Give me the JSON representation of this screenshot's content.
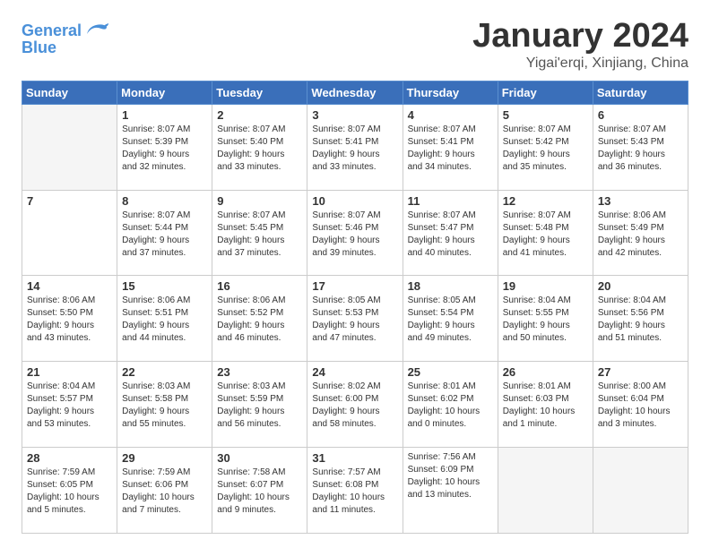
{
  "logo": {
    "line1": "General",
    "line2": "Blue"
  },
  "title": "January 2024",
  "subtitle": "Yigai'erqi, Xinjiang, China",
  "weekdays": [
    "Sunday",
    "Monday",
    "Tuesday",
    "Wednesday",
    "Thursday",
    "Friday",
    "Saturday"
  ],
  "weeks": [
    [
      {
        "day": "",
        "info": ""
      },
      {
        "day": "1",
        "info": "Sunrise: 8:07 AM\nSunset: 5:39 PM\nDaylight: 9 hours\nand 32 minutes."
      },
      {
        "day": "2",
        "info": "Sunrise: 8:07 AM\nSunset: 5:40 PM\nDaylight: 9 hours\nand 33 minutes."
      },
      {
        "day": "3",
        "info": "Sunrise: 8:07 AM\nSunset: 5:41 PM\nDaylight: 9 hours\nand 33 minutes."
      },
      {
        "day": "4",
        "info": "Sunrise: 8:07 AM\nSunset: 5:41 PM\nDaylight: 9 hours\nand 34 minutes."
      },
      {
        "day": "5",
        "info": "Sunrise: 8:07 AM\nSunset: 5:42 PM\nDaylight: 9 hours\nand 35 minutes."
      },
      {
        "day": "6",
        "info": "Sunrise: 8:07 AM\nSunset: 5:43 PM\nDaylight: 9 hours\nand 36 minutes."
      }
    ],
    [
      {
        "day": "7",
        "info": ""
      },
      {
        "day": "8",
        "info": "Sunrise: 8:07 AM\nSunset: 5:44 PM\nDaylight: 9 hours\nand 37 minutes."
      },
      {
        "day": "9",
        "info": "Sunrise: 8:07 AM\nSunset: 5:45 PM\nDaylight: 9 hours\nand 37 minutes."
      },
      {
        "day": "10",
        "info": "Sunrise: 8:07 AM\nSunset: 5:46 PM\nDaylight: 9 hours\nand 39 minutes."
      },
      {
        "day": "11",
        "info": "Sunrise: 8:07 AM\nSunset: 5:47 PM\nDaylight: 9 hours\nand 40 minutes."
      },
      {
        "day": "12",
        "info": "Sunrise: 8:07 AM\nSunset: 5:48 PM\nDaylight: 9 hours\nand 41 minutes."
      },
      {
        "day": "13",
        "info": "Sunrise: 8:06 AM\nSunset: 5:49 PM\nDaylight: 9 hours\nand 42 minutes."
      }
    ],
    [
      {
        "day": "14",
        "info": "Sunrise: 8:06 AM\nSunset: 5:50 PM\nDaylight: 9 hours\nand 43 minutes."
      },
      {
        "day": "15",
        "info": "Sunrise: 8:06 AM\nSunset: 5:51 PM\nDaylight: 9 hours\nand 44 minutes."
      },
      {
        "day": "16",
        "info": "Sunrise: 8:06 AM\nSunset: 5:52 PM\nDaylight: 9 hours\nand 46 minutes."
      },
      {
        "day": "17",
        "info": "Sunrise: 8:05 AM\nSunset: 5:53 PM\nDaylight: 9 hours\nand 47 minutes."
      },
      {
        "day": "18",
        "info": "Sunrise: 8:05 AM\nSunset: 5:54 PM\nDaylight: 9 hours\nand 49 minutes."
      },
      {
        "day": "19",
        "info": "Sunrise: 8:04 AM\nSunset: 5:55 PM\nDaylight: 9 hours\nand 50 minutes."
      },
      {
        "day": "20",
        "info": "Sunrise: 8:04 AM\nSunset: 5:56 PM\nDaylight: 9 hours\nand 51 minutes."
      }
    ],
    [
      {
        "day": "21",
        "info": "Sunrise: 8:04 AM\nSunset: 5:57 PM\nDaylight: 9 hours\nand 53 minutes."
      },
      {
        "day": "22",
        "info": "Sunrise: 8:03 AM\nSunset: 5:58 PM\nDaylight: 9 hours\nand 55 minutes."
      },
      {
        "day": "23",
        "info": "Sunrise: 8:03 AM\nSunset: 5:59 PM\nDaylight: 9 hours\nand 56 minutes."
      },
      {
        "day": "24",
        "info": "Sunrise: 8:02 AM\nSunset: 6:00 PM\nDaylight: 9 hours\nand 58 minutes."
      },
      {
        "day": "25",
        "info": "Sunrise: 8:01 AM\nSunset: 6:02 PM\nDaylight: 10 hours\nand 0 minutes."
      },
      {
        "day": "26",
        "info": "Sunrise: 8:01 AM\nSunset: 6:03 PM\nDaylight: 10 hours\nand 1 minute."
      },
      {
        "day": "27",
        "info": "Sunrise: 8:00 AM\nSunset: 6:04 PM\nDaylight: 10 hours\nand 3 minutes."
      }
    ],
    [
      {
        "day": "28",
        "info": "Sunrise: 7:59 AM\nSunset: 6:05 PM\nDaylight: 10 hours\nand 5 minutes."
      },
      {
        "day": "29",
        "info": "Sunrise: 7:59 AM\nSunset: 6:06 PM\nDaylight: 10 hours\nand 7 minutes."
      },
      {
        "day": "30",
        "info": "Sunrise: 7:58 AM\nSunset: 6:07 PM\nDaylight: 10 hours\nand 9 minutes."
      },
      {
        "day": "31",
        "info": "Sunrise: 7:57 AM\nSunset: 6:08 PM\nDaylight: 10 hours\nand 11 minutes."
      },
      {
        "day": "",
        "info": "Sunrise: 7:56 AM\nSunset: 6:09 PM\nDaylight: 10 hours\nand 13 minutes."
      },
      {
        "day": "",
        "info": ""
      },
      {
        "day": "",
        "info": ""
      }
    ]
  ]
}
